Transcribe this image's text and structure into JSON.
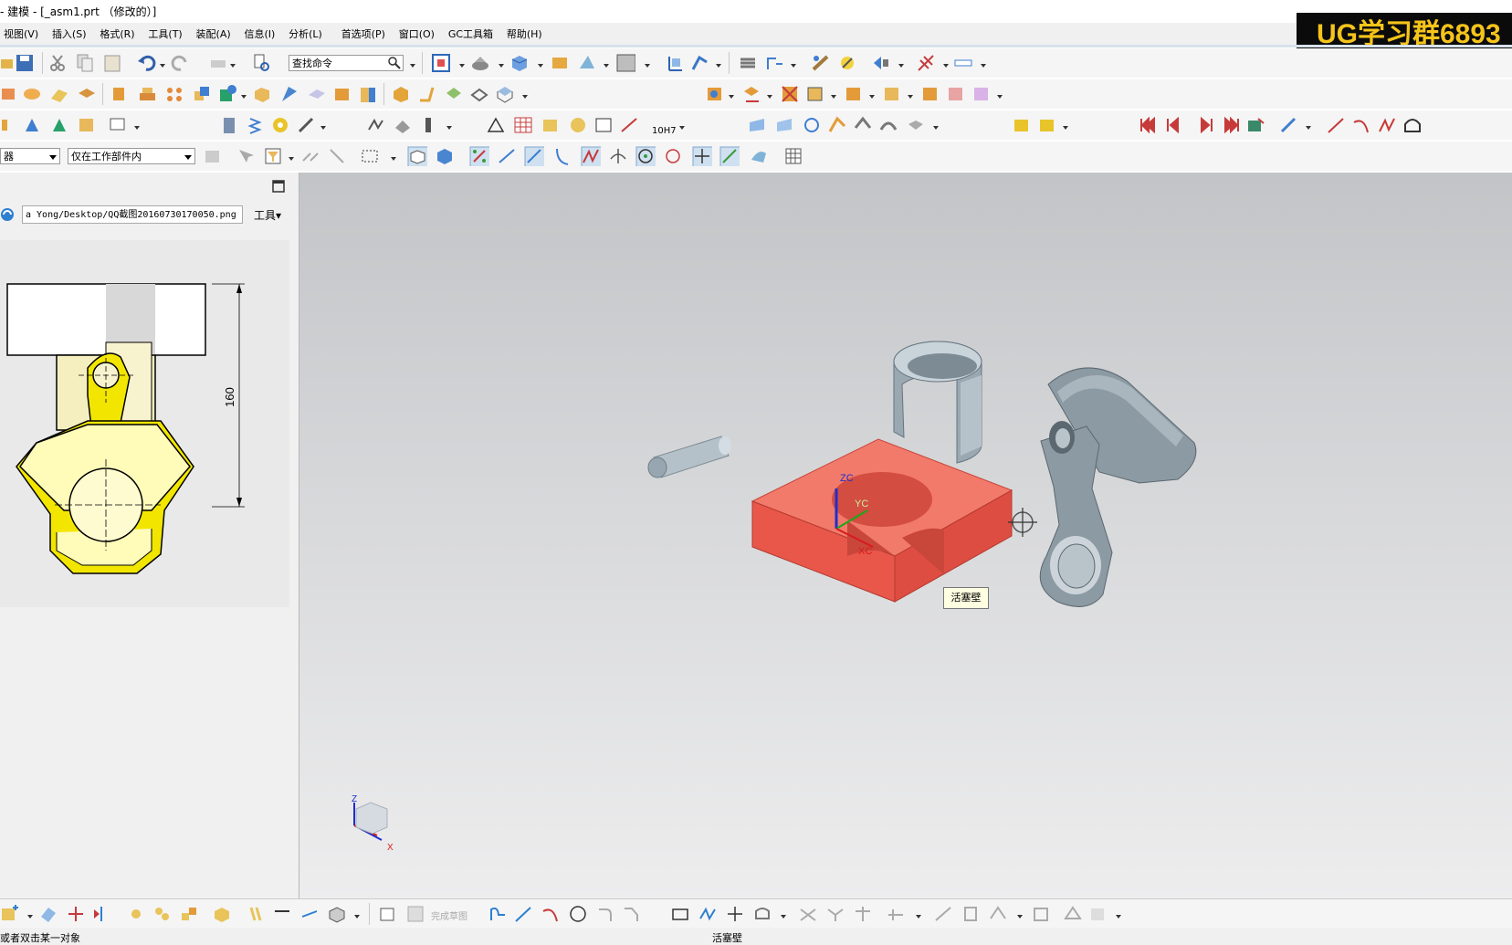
{
  "window": {
    "title": "- 建模 - [_asm1.prt （修改的）]"
  },
  "menu": [
    "视图(V)",
    "插入(S)",
    "格式(R)",
    "工具(T)",
    "装配(A)",
    "信息(I)",
    "分析(L)",
    "首选项(P)",
    "窗口(O)",
    "GC工具箱",
    "帮助(H)"
  ],
  "brand": {
    "text": "UG学习群6893"
  },
  "toolbar": {
    "find_placeholder": "查找命令",
    "filter_combo": "器",
    "scope_combo": "仅在工作部件内",
    "tolerance_label": "10H7"
  },
  "left_panel": {
    "path": "a Yong/Desktop/QQ截图20160730170050.png",
    "tools_label": "工具▾",
    "dimension_label": "160"
  },
  "viewport": {
    "tooltip": "活塞壁",
    "triad": {
      "zc": "ZC",
      "yc": "YC",
      "xc": "XC"
    },
    "wcs": {
      "z": "Z",
      "x": "X"
    }
  },
  "bottom_toolbar": {
    "finish_sketch": "完成草图"
  },
  "status": {
    "left": "或者双击某一对象",
    "center": "活塞壁"
  },
  "colors": {
    "accent_red": "#e8574a",
    "part_gray": "#8c9aa3",
    "yellow": "#fff7a8",
    "highlight": "#f2e600"
  }
}
